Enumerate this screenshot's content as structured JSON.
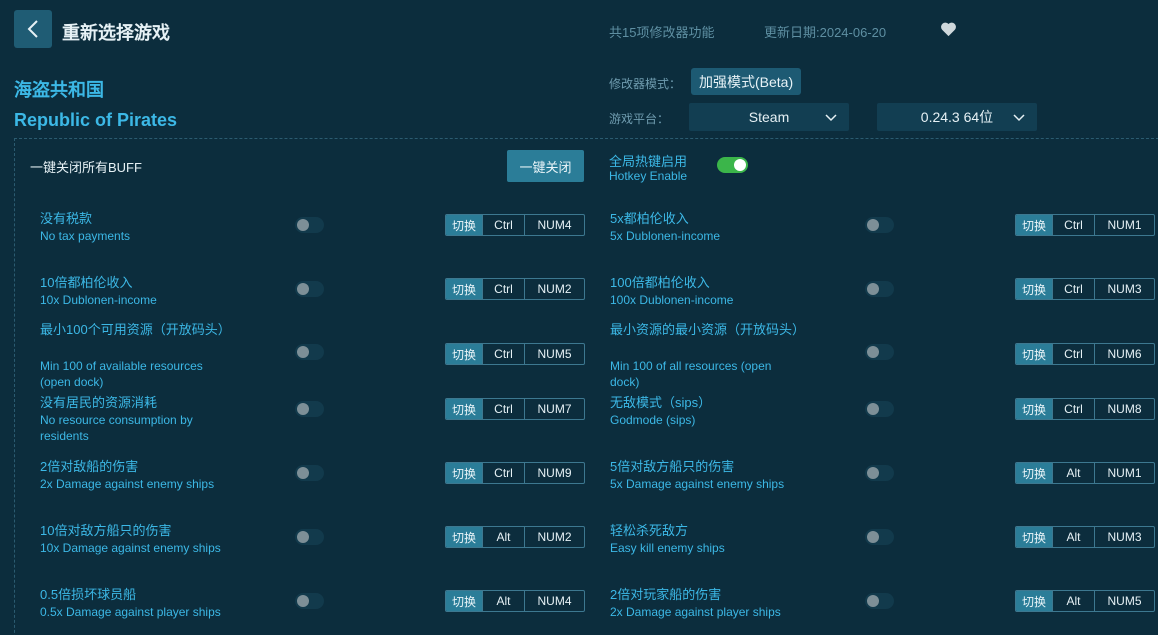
{
  "header": {
    "title": "重新选择游戏",
    "feature_count": "共15项修改器功能",
    "update_date": "更新日期:2024-06-20"
  },
  "game": {
    "name_cn": "海盗共和国",
    "name_en": "Republic of Pirates"
  },
  "settings": {
    "mode_label": "修改器模式：",
    "mode_value": "加强模式(Beta)",
    "platform_label": "游戏平台：",
    "platform_value": "Steam",
    "version_value": "0.24.3 64位"
  },
  "controls": {
    "disable_all_label": "一键关闭所有BUFF",
    "disable_all_button": "一键关闭",
    "hotkey_cn": "全局热键启用",
    "hotkey_en": "Hotkey Enable",
    "hotkey_enabled": true
  },
  "switch_label": "切换",
  "cheats": [
    {
      "cn": "没有税款",
      "en": "No tax payments",
      "mod": "Ctrl",
      "key": "NUM4",
      "enabled": false
    },
    {
      "cn": "5x都柏伦收入",
      "en": "5x Dublonen-income",
      "mod": "Ctrl",
      "key": "NUM1",
      "enabled": false
    },
    {
      "cn": "10倍都柏伦收入",
      "en": "10x Dublonen-income",
      "mod": "Ctrl",
      "key": "NUM2",
      "enabled": false
    },
    {
      "cn": "100倍都柏伦收入",
      "en": "100x Dublonen-income",
      "mod": "Ctrl",
      "key": "NUM3",
      "enabled": false
    },
    {
      "cn": "最小100个可用资源（开放码头）",
      "en": "Min 100 of available resources (open dock)",
      "mod": "Ctrl",
      "key": "NUM5",
      "enabled": false
    },
    {
      "cn": "最小资源的最小资源（开放码头）",
      "en": "Min 100 of all resources (open dock)",
      "mod": "Ctrl",
      "key": "NUM6",
      "enabled": false
    },
    {
      "cn": "没有居民的资源消耗",
      "en": "No resource consumption by residents",
      "mod": "Ctrl",
      "key": "NUM7",
      "enabled": false
    },
    {
      "cn": "无敌模式（sips）",
      "en": "Godmode (sips)",
      "mod": "Ctrl",
      "key": "NUM8",
      "enabled": false
    },
    {
      "cn": "2倍对敌船的伤害",
      "en": "2x Damage against enemy ships",
      "mod": "Ctrl",
      "key": "NUM9",
      "enabled": false
    },
    {
      "cn": "5倍对敌方船只的伤害",
      "en": "5x Damage against enemy ships",
      "mod": "Alt",
      "key": "NUM1",
      "enabled": false
    },
    {
      "cn": "10倍对敌方船只的伤害",
      "en": "10x Damage against enemy ships",
      "mod": "Alt",
      "key": "NUM2",
      "enabled": false
    },
    {
      "cn": "轻松杀死敌方",
      "en": "Easy kill enemy ships",
      "mod": "Alt",
      "key": "NUM3",
      "enabled": false
    },
    {
      "cn": "0.5倍损坏球员船",
      "en": "0.5x Damage against player ships",
      "mod": "Alt",
      "key": "NUM4",
      "enabled": false
    },
    {
      "cn": "2倍对玩家船的伤害",
      "en": "2x Damage against player ships",
      "mod": "Alt",
      "key": "NUM5",
      "enabled": false
    }
  ]
}
